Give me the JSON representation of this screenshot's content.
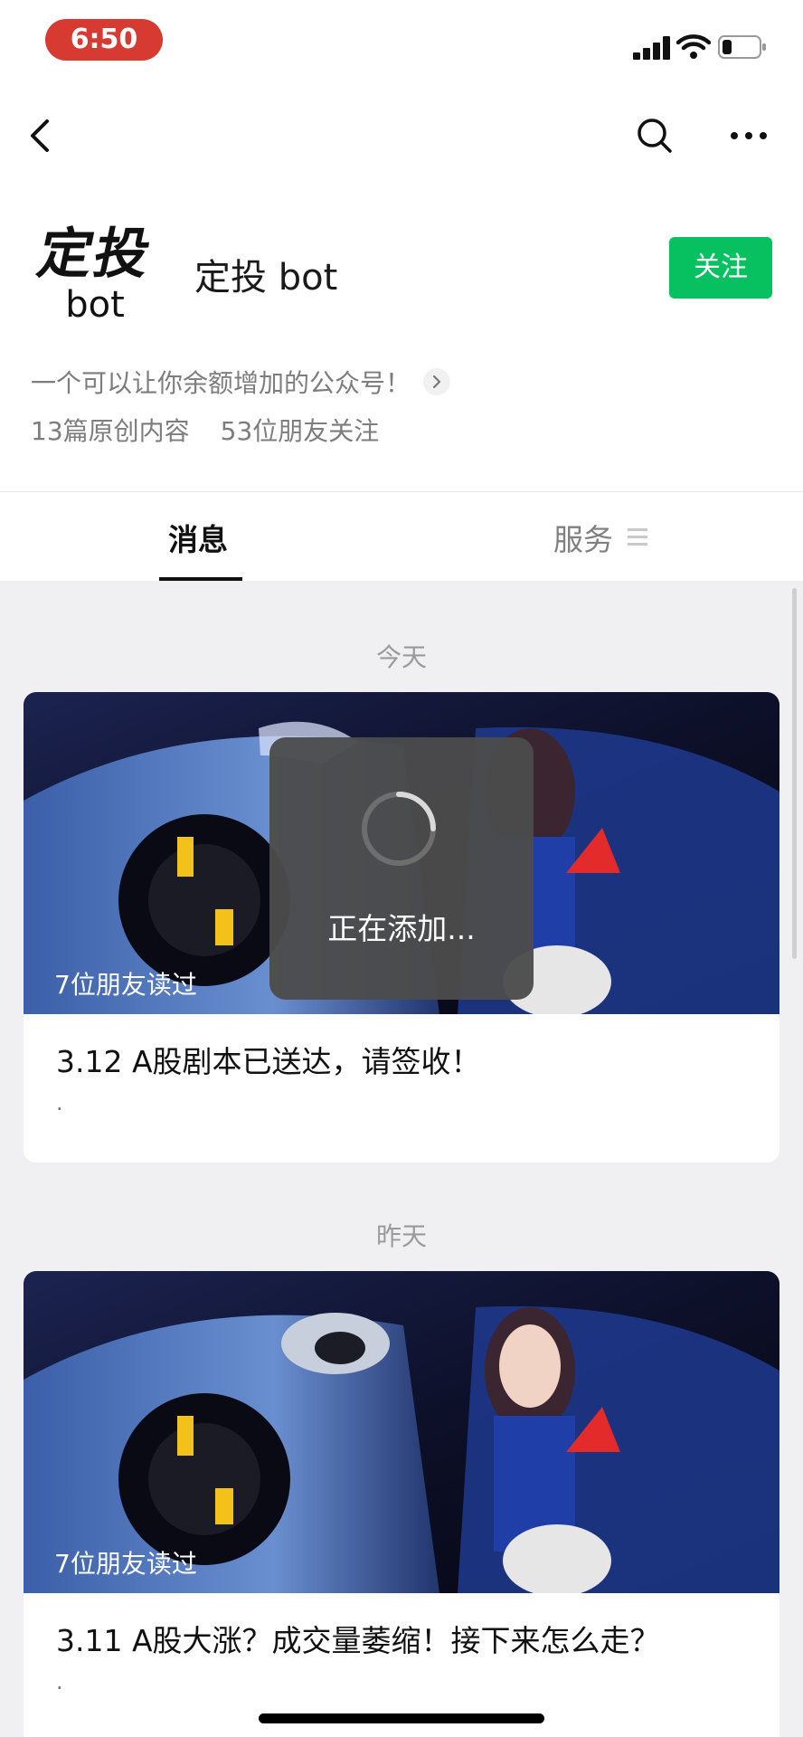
{
  "status": {
    "time": "6:50"
  },
  "header": {
    "logo_cn": "定投",
    "logo_en": "bot",
    "account_name": "定投 bot",
    "follow_label": "关注",
    "description": "一个可以让你余额增加的公众号！",
    "stats": [
      "13篇原创内容",
      "53位朋友关注"
    ]
  },
  "tabs": [
    {
      "label": "消息",
      "active": true
    },
    {
      "label": "服务",
      "active": false
    }
  ],
  "feed": [
    {
      "date": "今天",
      "readers": "7位朋友读过",
      "title": "3.12 A股剧本已送达，请签收！",
      "dot": "."
    },
    {
      "date": "昨天",
      "readers": "7位朋友读过",
      "title": "3.11 A股大涨？成交量萎缩！接下来怎么走？",
      "dot": "."
    }
  ],
  "toast": {
    "text": "正在添加..."
  },
  "colors": {
    "follow": "#07c160",
    "time_pill": "#d73a31",
    "bg": "#f0eff2"
  }
}
